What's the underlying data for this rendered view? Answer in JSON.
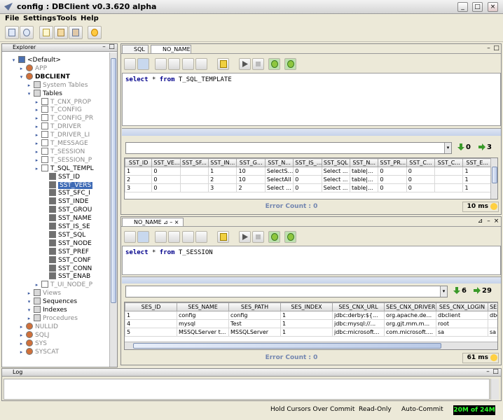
{
  "window": {
    "title": "config : DBClient v0.3.620 alpha"
  },
  "menu": [
    "File",
    "Settings",
    "Tools",
    "Help"
  ],
  "explorer": {
    "title": "Explorer",
    "items": [
      {
        "label": "<Default>",
        "icon": "db-icon",
        "level": 1
      },
      {
        "label": "APP",
        "icon": "schema-icon",
        "level": 2,
        "dim": true
      },
      {
        "label": "DBCLIENT",
        "icon": "schema-icon",
        "level": 2
      },
      {
        "label": "System Tables",
        "icon": "folder-icon",
        "level": 3,
        "dim": true
      },
      {
        "label": "Tables",
        "icon": "folder-icon",
        "level": 3
      },
      {
        "label": "T_CNX_PROP",
        "icon": "table-icon",
        "level": 4,
        "dim": true
      },
      {
        "label": "T_CONFIG",
        "icon": "table-icon",
        "level": 4,
        "dim": true
      },
      {
        "label": "T_CONFIG_PR",
        "icon": "table-icon",
        "level": 4,
        "dim": true
      },
      {
        "label": "T_DRIVER",
        "icon": "table-icon",
        "level": 4,
        "dim": true
      },
      {
        "label": "T_DRIVER_LI",
        "icon": "table-icon",
        "level": 4,
        "dim": true
      },
      {
        "label": "T_MESSAGE",
        "icon": "table-icon",
        "level": 4,
        "dim": true
      },
      {
        "label": "T_SESSION",
        "icon": "table-icon",
        "level": 4,
        "dim": true
      },
      {
        "label": "T_SESSION_P",
        "icon": "table-icon",
        "level": 4,
        "dim": true
      },
      {
        "label": "T_SQL_TEMPL",
        "icon": "table-icon",
        "level": 4
      },
      {
        "label": "SST_ID",
        "icon": "column-icon",
        "level": 5
      },
      {
        "label": "SST_VERS",
        "icon": "column-icon",
        "level": 5,
        "selected": true
      },
      {
        "label": "SST_SFC_I",
        "icon": "column-icon",
        "level": 5
      },
      {
        "label": "SST_INDE",
        "icon": "column-icon",
        "level": 5
      },
      {
        "label": "SST_GROU",
        "icon": "column-icon",
        "level": 5
      },
      {
        "label": "SST_NAME",
        "icon": "column-icon",
        "level": 5
      },
      {
        "label": "SST_IS_SE",
        "icon": "column-icon",
        "level": 5
      },
      {
        "label": "SST_SQL",
        "icon": "column-icon",
        "level": 5
      },
      {
        "label": "SST_NODE",
        "icon": "column-icon",
        "level": 5
      },
      {
        "label": "SST_PREF",
        "icon": "column-icon",
        "level": 5
      },
      {
        "label": "SST_CONF",
        "icon": "column-icon",
        "level": 5
      },
      {
        "label": "SST_CONN",
        "icon": "column-icon",
        "level": 5
      },
      {
        "label": "SST_ENAB",
        "icon": "column-icon",
        "level": 5
      },
      {
        "label": "T_UI_NODE_P",
        "icon": "table-icon",
        "level": 4,
        "dim": true
      },
      {
        "label": "Views",
        "icon": "folder-icon",
        "level": 3,
        "dim": true
      },
      {
        "label": "Sequences",
        "icon": "folder-icon",
        "level": 3
      },
      {
        "label": "Indexes",
        "icon": "folder-icon",
        "level": 3
      },
      {
        "label": "Procedures",
        "icon": "folder-icon",
        "level": 3,
        "dim": true
      },
      {
        "label": "NULLID",
        "icon": "schema-icon",
        "level": 2,
        "dim": true
      },
      {
        "label": "SQLJ",
        "icon": "schema-icon",
        "level": 2,
        "dim": true
      },
      {
        "label": "SYS",
        "icon": "schema-icon",
        "level": 2,
        "dim": true
      },
      {
        "label": "SYSCAT",
        "icon": "schema-icon",
        "level": 2,
        "dim": true
      }
    ]
  },
  "top_panel": {
    "tab1": "SQL",
    "tab2": "NO_NAME",
    "query_kw1": "select",
    "query_star": "*",
    "query_kw2": "from",
    "query_rest": "T_SQL_TEMPLATE",
    "count_down": "0",
    "count_right": "3",
    "columns": [
      "SST_ID",
      "SST_VE...",
      "SST_SF...",
      "SST_IN...",
      "SST_G...",
      "SST_N...",
      "SST_IS_...",
      "SST_SQL",
      "SST_N...",
      "SST_PR...",
      "SST_C...",
      "SST_C...",
      "SST_E..."
    ],
    "rows": [
      [
        "1",
        "0",
        "",
        "1",
        "10",
        "SelectS...",
        "0",
        "Select ...",
        "table|...",
        "0",
        "0",
        "",
        "1"
      ],
      [
        "2",
        "0",
        "",
        "2",
        "10",
        "SelectAll",
        "0",
        "Select ...",
        "table|...",
        "0",
        "0",
        "",
        "1"
      ],
      [
        "3",
        "0",
        "",
        "3",
        "2",
        "Select ...",
        "0",
        "Select ...",
        "table|...",
        "0",
        "0",
        "",
        "1"
      ]
    ],
    "error_count": "Error Count : 0",
    "time": "10 ms"
  },
  "bottom_panel": {
    "tab": "NO_NAME",
    "query_kw1": "select",
    "query_star": "*",
    "query_kw2": "from",
    "query_rest": "T_SESSION",
    "count_down": "6",
    "count_right": "29",
    "columns": [
      "SES_ID",
      "SES_NAME",
      "SES_PATH",
      "SES_INDEX",
      "SES_CNX_URL",
      "SES_CNX_DRIVER",
      "SES_CNX_LOGIN",
      "SES..."
    ],
    "rows": [
      [
        "1",
        "config",
        "config",
        "1",
        "jdbc:derby:${...",
        "org.apache.de...",
        "dbclient",
        "dbc"
      ],
      [
        "4",
        "mysql",
        "Test",
        "1",
        "jdbc:mysql://...",
        "org.gjt.mm.m...",
        "root",
        ""
      ],
      [
        "5",
        "MSSQLServer t...",
        "MSSQLServer",
        "1",
        "jdbc:microsoft...",
        "com.microsoft....",
        "sa",
        "sa"
      ]
    ],
    "error_count": "Error Count : 0",
    "time": "61 ms"
  },
  "log": {
    "title": "Log"
  },
  "status": {
    "hold": "Hold Cursors Over Commit",
    "readonly": "Read-Only",
    "autocommit": "Auto-Commit",
    "memory": "20M of 24M"
  },
  "colors": {
    "keyword": "#00008b",
    "error": "#7386b0",
    "selected": "#3d6ab5",
    "memory": "#2cff2c"
  }
}
